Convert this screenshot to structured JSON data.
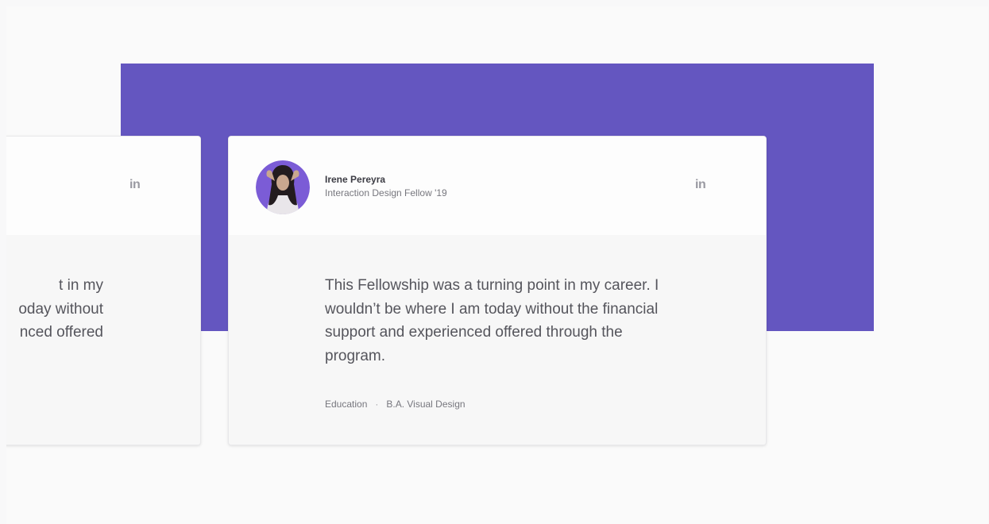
{
  "colors": {
    "accent": "#6456c0",
    "avatar_ring": "#7b5cd6"
  },
  "cards": {
    "left": {
      "linkedin_label": "in",
      "quote_lines": [
        "t in my",
        "oday without",
        "nced offered"
      ]
    },
    "main": {
      "name": "Irene Pereyra",
      "role": "Interaction Design Fellow '19",
      "linkedin_label": "in",
      "quote": "This Fellowship was a turning point in my career. I wouldn’t be where I am today without the financial support and experienced offered through the program.",
      "meta_category": "Education",
      "meta_separator": "·",
      "meta_degree": "B.A. Visual Design"
    }
  }
}
